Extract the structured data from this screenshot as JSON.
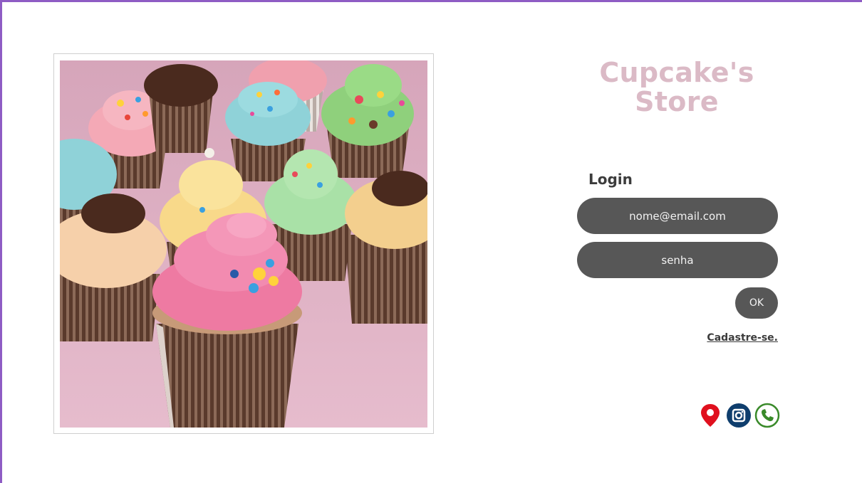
{
  "store": {
    "title_line1": "Cupcake's",
    "title_line2": "Store"
  },
  "login": {
    "heading": "Login",
    "email_placeholder": "nome@email.com",
    "password_placeholder": "senha",
    "ok_label": "OK",
    "signup_link": "Cadastre-se."
  },
  "social_icons": [
    "location-pin-icon",
    "instagram-icon",
    "phone-icon"
  ],
  "colors": {
    "frame_accent": "#8e5cc4",
    "title_pink": "#dbbac6",
    "pill_gray": "#575757",
    "photo_background": "#d9a7bb",
    "pin_red": "#e0101e",
    "instagram_blue": "#0f3e6d",
    "phone_green": "#3a8a2a"
  }
}
